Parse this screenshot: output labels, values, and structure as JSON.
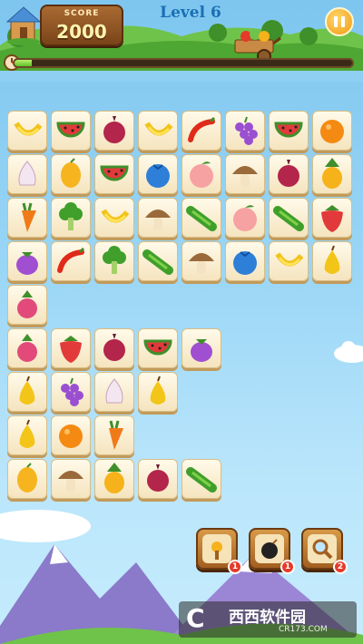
{
  "header": {
    "score_label": "SCORE",
    "score_value": "2000",
    "level_title": "Level 6",
    "progress": 0.05
  },
  "board": {
    "tiles": [
      [
        "banana",
        "watermelon",
        "onion",
        "banana",
        "chili",
        "grape",
        "watermelon",
        "orange"
      ],
      [
        "garlic",
        "mango",
        "watermelon",
        "blueberry",
        "peach",
        "mushroom",
        "onion",
        "pineapple"
      ],
      [
        "carrot",
        "broccoli",
        "banana",
        "mushroom",
        "cucumber",
        "peach",
        "cucumber",
        "strawberry"
      ],
      [
        "eggplant",
        "chili",
        "broccoli",
        "cucumber",
        "mushroom",
        "blueberry",
        "banana",
        "pear"
      ],
      [
        "radish"
      ],
      [
        "radish",
        "strawberry",
        "onion",
        "watermelon",
        "eggplant"
      ],
      [
        "pear",
        "grape",
        "garlic",
        "pear"
      ],
      [
        "pear",
        "orange",
        "carrot"
      ],
      [
        "mango",
        "mushroom",
        "pineapple",
        "onion",
        "cucumber"
      ]
    ]
  },
  "boosters": [
    {
      "name": "hint",
      "icon": "flower-key-icon",
      "count": "1"
    },
    {
      "name": "bomb",
      "icon": "bomb-icon",
      "count": "1"
    },
    {
      "name": "search",
      "icon": "magnifier-icon",
      "count": "2"
    }
  ],
  "watermark": {
    "logo": "C",
    "title": "西西软件园",
    "url": "CR173.COM"
  },
  "colors": {
    "accent": "#f09a12",
    "level": "#1a6fb5",
    "board_tile": "#fffaea"
  }
}
